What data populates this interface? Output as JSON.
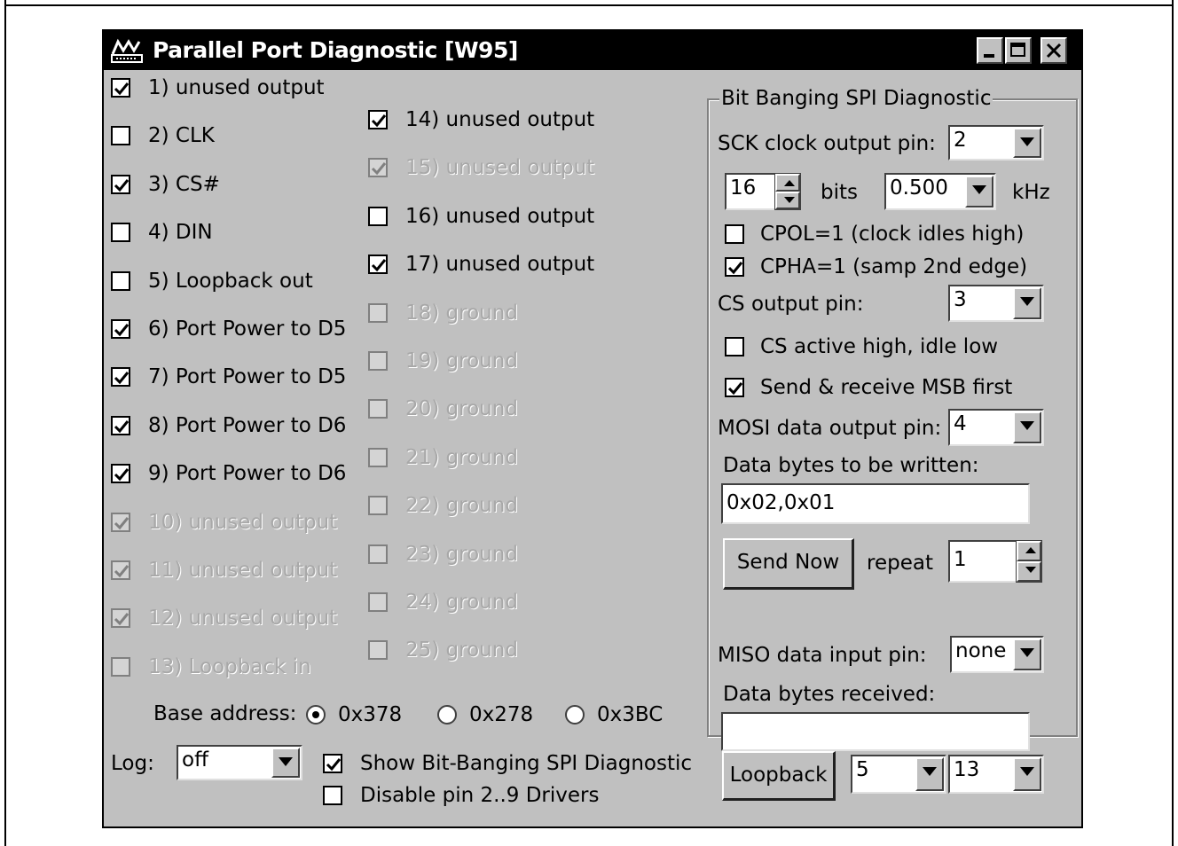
{
  "window": {
    "title": "Parallel Port Diagnostic [W95]",
    "minimize_label": "minimize",
    "maximize_label": "maximize",
    "close_label": "close"
  },
  "pins_left": [
    {
      "label": "1) unused output",
      "checked": true,
      "enabled": true
    },
    {
      "label": "2) CLK",
      "checked": false,
      "enabled": true
    },
    {
      "label": "3) CS#",
      "checked": true,
      "enabled": true
    },
    {
      "label": "4) DIN",
      "checked": false,
      "enabled": true
    },
    {
      "label": "5) Loopback out",
      "checked": false,
      "enabled": true
    },
    {
      "label": "6) Port Power to D5",
      "checked": true,
      "enabled": true
    },
    {
      "label": "7) Port Power to D5",
      "checked": true,
      "enabled": true
    },
    {
      "label": "8) Port Power to D6",
      "checked": true,
      "enabled": true
    },
    {
      "label": "9) Port Power to D6",
      "checked": true,
      "enabled": true
    },
    {
      "label": "10) unused output",
      "checked": true,
      "enabled": false
    },
    {
      "label": "11) unused output",
      "checked": true,
      "enabled": false
    },
    {
      "label": "12) unused output",
      "checked": true,
      "enabled": false
    },
    {
      "label": "13) Loopback in",
      "checked": false,
      "enabled": false
    }
  ],
  "pins_right": [
    {
      "label": "14) unused output",
      "checked": true,
      "enabled": true
    },
    {
      "label": "15) unused output",
      "checked": true,
      "enabled": false
    },
    {
      "label": "16) unused output",
      "checked": false,
      "enabled": true
    },
    {
      "label": "17) unused output",
      "checked": true,
      "enabled": true
    },
    {
      "label": "18) ground",
      "checked": false,
      "enabled": false
    },
    {
      "label": "19) ground",
      "checked": false,
      "enabled": false
    },
    {
      "label": "20) ground",
      "checked": false,
      "enabled": false
    },
    {
      "label": "21) ground",
      "checked": false,
      "enabled": false
    },
    {
      "label": "22) ground",
      "checked": false,
      "enabled": false
    },
    {
      "label": "23) ground",
      "checked": false,
      "enabled": false
    },
    {
      "label": "24) ground",
      "checked": false,
      "enabled": false
    },
    {
      "label": "25) ground",
      "checked": false,
      "enabled": false
    }
  ],
  "base_address": {
    "label": "Base address:",
    "options": [
      "0x378",
      "0x278",
      "0x3BC"
    ],
    "selected": "0x378"
  },
  "log": {
    "label": "Log:",
    "value": "off"
  },
  "show_spi": {
    "label": "Show Bit-Banging SPI Diagnostic",
    "checked": true
  },
  "disable_drivers": {
    "label": "Disable pin 2..9 Drivers",
    "checked": false
  },
  "spi": {
    "group_title": "Bit Banging SPI Diagnostic",
    "sck_label": "SCK clock output pin:",
    "sck_value": "2",
    "bits_value": "16",
    "bits_label": "bits",
    "freq_value": "0.500",
    "freq_unit": "kHz",
    "cpol": {
      "label": "CPOL=1 (clock idles high)",
      "checked": false
    },
    "cpha": {
      "label": "CPHA=1 (samp 2nd edge)",
      "checked": true
    },
    "cs_label": "CS output pin:",
    "cs_value": "3",
    "cs_active_high": {
      "label": "CS active high, idle low",
      "checked": false
    },
    "msb_first": {
      "label": "Send & receive MSB first",
      "checked": true
    },
    "mosi_label": "MOSI data output pin:",
    "mosi_value": "4",
    "write_label": "Data bytes to be written:",
    "write_value": "0x02,0x01",
    "send_button": "Send Now",
    "repeat_label": "repeat",
    "repeat_value": "1",
    "miso_label": "MISO data input pin:",
    "miso_value": "none",
    "received_label": "Data bytes received:",
    "received_value": ""
  },
  "loopback": {
    "button": "Loopback",
    "out_pin": "5",
    "in_pin": "13"
  }
}
